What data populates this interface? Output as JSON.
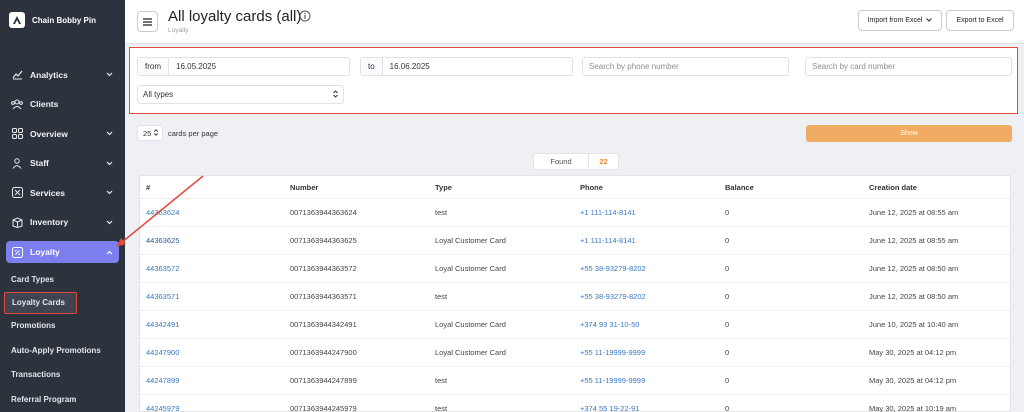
{
  "app": {
    "brand": "Chain Bobby Pin"
  },
  "sidebar": {
    "items": [
      {
        "label": "Analytics",
        "icon": "chart-icon",
        "chevron": true
      },
      {
        "label": "Clients",
        "icon": "clients-icon",
        "chevron": false
      },
      {
        "label": "Overview",
        "icon": "grid-icon",
        "chevron": true
      },
      {
        "label": "Staff",
        "icon": "person-icon",
        "chevron": true
      },
      {
        "label": "Services",
        "icon": "scissors-icon",
        "chevron": true
      },
      {
        "label": "Inventory",
        "icon": "box-icon",
        "chevron": true
      },
      {
        "label": "Loyalty",
        "icon": "loyalty-icon",
        "chevron": true
      }
    ],
    "loyalty_sub": [
      "Card Types",
      "Loyalty Cards",
      "Promotions",
      "Auto-Apply Promotions",
      "Transactions",
      "Referral Program"
    ]
  },
  "header": {
    "title": "All loyalty cards (all)",
    "breadcrumb": "Loyalty",
    "import_label": "Import from Excel",
    "export_label": "Export to Excel"
  },
  "filters": {
    "from_label": "from",
    "from_value": "16.05.2025",
    "to_label": "to",
    "to_value": "16.06.2025",
    "phone_placeholder": "Search by phone number",
    "card_placeholder": "Search by card number",
    "type_value": "All types"
  },
  "pagination": {
    "per_page": "25",
    "per_page_label": "cards per page"
  },
  "show_label": "Show",
  "found": {
    "label": "Found",
    "count": "22"
  },
  "table": {
    "headers": [
      "#",
      "Number",
      "Type",
      "Phone",
      "Balance",
      "Creation date"
    ],
    "rows": [
      {
        "id": "44363624",
        "number": "0071363944363624",
        "type": "test",
        "phone": "+1 111-114-8141",
        "balance": "0",
        "date": "June 12, 2025 at 08:55 am"
      },
      {
        "id": "44363625",
        "number": "0071363944363625",
        "type": "Loyal Customer Card",
        "phone": "+1 111-114-8141",
        "balance": "0",
        "date": "June 12, 2025 at 08:55 am"
      },
      {
        "id": "44363572",
        "number": "0071363944363572",
        "type": "Loyal Customer Card",
        "phone": "+55 38-93279-8202",
        "balance": "0",
        "date": "June 12, 2025 at 08:50 am"
      },
      {
        "id": "44363571",
        "number": "0071363944363571",
        "type": "test",
        "phone": "+55 38-93279-8202",
        "balance": "0",
        "date": "June 12, 2025 at 08:50 am"
      },
      {
        "id": "44342491",
        "number": "0071363944342491",
        "type": "Loyal Customer Card",
        "phone": "+374 93 31-10-50",
        "balance": "0",
        "date": "June 10, 2025 at 10:40 am"
      },
      {
        "id": "44247900",
        "number": "0071363944247900",
        "type": "Loyal Customer Card",
        "phone": "+55 11-19999-9999",
        "balance": "0",
        "date": "May 30, 2025 at 04:12 pm"
      },
      {
        "id": "44247899",
        "number": "0071363944247899",
        "type": "test",
        "phone": "+55 11-19999-9999",
        "balance": "0",
        "date": "May 30, 2025 at 04:12 pm"
      },
      {
        "id": "44245979",
        "number": "0071363944245979",
        "type": "test",
        "phone": "+374 55 19-22-91",
        "balance": "0",
        "date": "May 30, 2025 at 10:19 am"
      }
    ]
  },
  "colors": {
    "sidebar_bg": "#2c333d",
    "active_nav": "#7c7ff0",
    "accent_orange": "#f0ac63",
    "link_blue": "#3a78c2",
    "highlight_red": "#e04b3b"
  }
}
